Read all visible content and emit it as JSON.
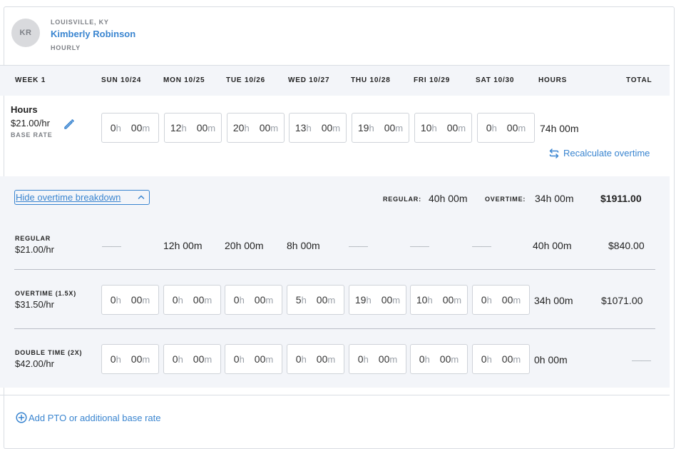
{
  "employee": {
    "initials": "KR",
    "location": "LOUISVILLE, KY",
    "name": "Kimberly Robinson",
    "pay_type": "HOURLY"
  },
  "week": {
    "label": "WEEK 1",
    "days": [
      "SUN 10/24",
      "MON 10/25",
      "TUE 10/26",
      "WED 10/27",
      "THU 10/28",
      "FRI 10/29",
      "SAT 10/30"
    ],
    "hours_col": "HOURS",
    "total_col": "TOTAL"
  },
  "hours_row": {
    "label": "Hours",
    "rate": "$21.00/hr",
    "rate_caption": "BASE RATE",
    "entries": [
      {
        "h": "0",
        "m": "00"
      },
      {
        "h": "12",
        "m": "00"
      },
      {
        "h": "20",
        "m": "00"
      },
      {
        "h": "13",
        "m": "00"
      },
      {
        "h": "19",
        "m": "00"
      },
      {
        "h": "10",
        "m": "00"
      },
      {
        "h": "0",
        "m": "00"
      }
    ],
    "total_hours": "74h 00m",
    "recalc_label": "Recalculate overtime"
  },
  "unit_h": "h",
  "unit_m": "m",
  "breakdown": {
    "toggle_label": "Hide overtime breakdown",
    "regular_label": "REGULAR:",
    "regular_value": "40h 00m",
    "overtime_label": "OVERTIME:",
    "overtime_value": "34h 00m",
    "grand_total": "$1911.00",
    "regular": {
      "label": "REGULAR",
      "rate": "$21.00/hr",
      "days": [
        "——",
        "12h 00m",
        "20h 00m",
        "8h 00m",
        "——",
        "——",
        "——"
      ],
      "hours": "40h 00m",
      "total": "$840.00"
    },
    "overtime": {
      "label": "OVERTIME (1.5X)",
      "rate": "$31.50/hr",
      "entries": [
        {
          "h": "0",
          "m": "00"
        },
        {
          "h": "0",
          "m": "00"
        },
        {
          "h": "0",
          "m": "00"
        },
        {
          "h": "5",
          "m": "00"
        },
        {
          "h": "19",
          "m": "00"
        },
        {
          "h": "10",
          "m": "00"
        },
        {
          "h": "0",
          "m": "00"
        }
      ],
      "hours": "34h 00m",
      "total": "$1071.00"
    },
    "double": {
      "label": "DOUBLE TIME (2X)",
      "rate": "$42.00/hr",
      "entries": [
        {
          "h": "0",
          "m": "00"
        },
        {
          "h": "0",
          "m": "00"
        },
        {
          "h": "0",
          "m": "00"
        },
        {
          "h": "0",
          "m": "00"
        },
        {
          "h": "0",
          "m": "00"
        },
        {
          "h": "0",
          "m": "00"
        },
        {
          "h": "0",
          "m": "00"
        }
      ],
      "hours": "0h 00m",
      "total": "——"
    }
  },
  "add_pto_label": "Add PTO or additional base rate",
  "colors": {
    "accent": "#3a85d0",
    "section_bg": "#f3f5f9",
    "border": "#cfd3d9"
  }
}
